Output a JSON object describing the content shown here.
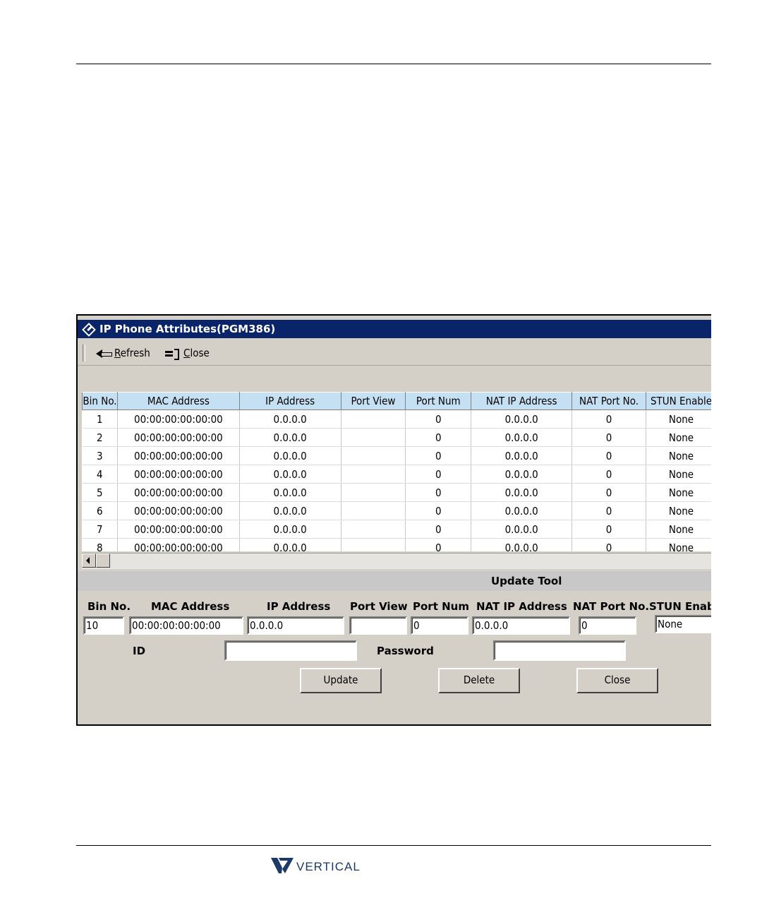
{
  "window": {
    "title": "IP Phone Attributes(PGM386)"
  },
  "toolbar": {
    "refresh_label_hot": "R",
    "refresh_label_rest": "efresh",
    "close_label_hot": "C",
    "close_label_rest": "lose"
  },
  "grid": {
    "columns": [
      "Bin No.",
      "MAC Address",
      "IP Address",
      "Port View",
      "Port Num",
      "NAT IP Address",
      "NAT Port No.",
      "STUN Enable"
    ],
    "rows": [
      [
        "1",
        "00:00:00:00:00:00",
        "0.0.0.0",
        "",
        "0",
        "0.0.0.0",
        "0",
        "None"
      ],
      [
        "2",
        "00:00:00:00:00:00",
        "0.0.0.0",
        "",
        "0",
        "0.0.0.0",
        "0",
        "None"
      ],
      [
        "3",
        "00:00:00:00:00:00",
        "0.0.0.0",
        "",
        "0",
        "0.0.0.0",
        "0",
        "None"
      ],
      [
        "4",
        "00:00:00:00:00:00",
        "0.0.0.0",
        "",
        "0",
        "0.0.0.0",
        "0",
        "None"
      ],
      [
        "5",
        "00:00:00:00:00:00",
        "0.0.0.0",
        "",
        "0",
        "0.0.0.0",
        "0",
        "None"
      ],
      [
        "6",
        "00:00:00:00:00:00",
        "0.0.0.0",
        "",
        "0",
        "0.0.0.0",
        "0",
        "None"
      ],
      [
        "7",
        "00:00:00:00:00:00",
        "0.0.0.0",
        "",
        "0",
        "0.0.0.0",
        "0",
        "None"
      ],
      [
        "8",
        "00:00:00:00:00:00",
        "0.0.0.0",
        "",
        "0",
        "0.0.0.0",
        "0",
        "None"
      ]
    ]
  },
  "update_tool": {
    "title": "Update Tool",
    "labels": {
      "bin_no": "Bin No.",
      "mac_address": "MAC Address",
      "ip_address": "IP Address",
      "port_view": "Port View",
      "port_num": "Port Num",
      "nat_ip_address": "NAT IP Address",
      "nat_port_no": "NAT Port No.",
      "stun_enable": "STUN Enable",
      "id": "ID",
      "password": "Password"
    },
    "values": {
      "bin_no": "10",
      "mac_address": "00:00:00:00:00:00",
      "ip_address": "0.0.0.0",
      "port_view": "",
      "port_num": "0",
      "nat_ip_address": "0.0.0.0",
      "nat_port_no": "0",
      "stun_enable": "None",
      "id": "",
      "password": ""
    },
    "buttons": {
      "update": "Update",
      "delete": "Delete",
      "close": "Close"
    }
  },
  "footer": {
    "logo_text": "VERTICAL"
  },
  "colors": {
    "titlebar": "#0a246a",
    "header_bg": "#c6e0f3",
    "window_bg": "#d4d0c8",
    "logo": "#1b3a6b"
  }
}
